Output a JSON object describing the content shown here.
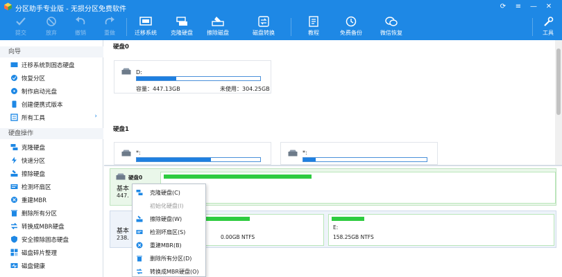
{
  "app": {
    "title": "分区助手专业版 - 无损分区免费软件"
  },
  "toolbar": {
    "buttons": [
      {
        "label": "提交",
        "icon": "check-icon",
        "disabled": true
      },
      {
        "label": "放弃",
        "icon": "cancel-icon",
        "disabled": true
      },
      {
        "label": "撤销",
        "icon": "undo-icon",
        "disabled": true
      },
      {
        "label": "重做",
        "icon": "redo-icon",
        "disabled": true
      },
      {
        "label": "迁移系统",
        "icon": "migrate-os-icon",
        "disabled": false
      },
      {
        "label": "克隆硬盘",
        "icon": "clone-disk-icon",
        "disabled": false
      },
      {
        "label": "擦除磁盘",
        "icon": "wipe-disk-icon",
        "disabled": false
      },
      {
        "label": "磁盘转换",
        "icon": "disk-convert-icon",
        "disabled": false
      },
      {
        "label": "教程",
        "icon": "tutorial-icon",
        "disabled": false
      },
      {
        "label": "免费备份",
        "icon": "free-backup-icon",
        "disabled": false
      },
      {
        "label": "微信恢复",
        "icon": "wechat-recovery-icon",
        "disabled": false
      },
      {
        "label": "工具",
        "icon": "tools-icon",
        "disabled": false
      }
    ]
  },
  "sidebar": {
    "wizard_title": "向导",
    "wizard_items": [
      {
        "label": "迁移系统到固态硬盘",
        "icon": "migrate-ssd-icon"
      },
      {
        "label": "恢复分区",
        "icon": "recover-partition-icon"
      },
      {
        "label": "制作启动光盘",
        "icon": "boot-disc-icon"
      },
      {
        "label": "创建便携式版本",
        "icon": "portable-version-icon"
      },
      {
        "label": "所有工具",
        "icon": "all-tools-icon"
      }
    ],
    "disk_ops_title": "硬盘操作",
    "disk_ops_items": [
      {
        "label": "克隆硬盘",
        "icon": "clone-disk-icon"
      },
      {
        "label": "快速分区",
        "icon": "quick-partition-icon"
      },
      {
        "label": "擦除硬盘",
        "icon": "wipe-disk-icon"
      },
      {
        "label": "检测坏扇区",
        "icon": "bad-sector-icon"
      },
      {
        "label": "重建MBR",
        "icon": "rebuild-mbr-icon"
      },
      {
        "label": "删除所有分区",
        "icon": "delete-partitions-icon"
      },
      {
        "label": "转换成MBR硬盘",
        "icon": "convert-mbr-icon"
      },
      {
        "label": "安全擦除固态硬盘",
        "icon": "secure-erase-icon"
      },
      {
        "label": "磁盘碎片整理",
        "icon": "defrag-icon"
      },
      {
        "label": "磁盘健康",
        "icon": "disk-health-icon"
      }
    ]
  },
  "disk_map": {
    "disk0": {
      "title": "硬盘0",
      "volume": "D:",
      "capacity": "容量：447.13GB",
      "unused": "未使用：304.25GB",
      "used_fraction": 0.32
    },
    "disk1": {
      "title": "硬盘1",
      "volumes": [
        {
          "label": "*:",
          "used_fraction": 0.6
        },
        {
          "label": "*:",
          "used_fraction": 0.1
        }
      ]
    }
  },
  "strip": {
    "row1": {
      "disk_label": "硬盘0",
      "type_prefix": "基本",
      "size_prefix": "447.",
      "used_fraction": 0.38
    },
    "row2": {
      "type_prefix": "基本",
      "size_prefix": "238.",
      "partitions": [
        {
          "label": "",
          "info": "0.00GB NTFS",
          "used_fraction": 0.55
        },
        {
          "label": "E:",
          "info": "158.25GB NTFS",
          "used_fraction": 0.15
        }
      ]
    }
  },
  "context_menu": {
    "items": [
      {
        "label": "克隆硬盘(C)",
        "icon": "clone-disk-icon",
        "disabled": false
      },
      {
        "label": "初始化硬盘(I)",
        "icon": "",
        "disabled": true
      },
      {
        "label": "擦除硬盘(W)",
        "icon": "wipe-disk-icon",
        "disabled": false
      },
      {
        "label": "检测坏扇区(S)",
        "icon": "bad-sector-icon",
        "disabled": false
      },
      {
        "label": "重建MBR(B)",
        "icon": "rebuild-mbr-icon",
        "disabled": false
      },
      {
        "label": "删除所有分区(D)",
        "icon": "delete-partitions-icon",
        "disabled": false
      },
      {
        "label": "转换成MBR硬盘(O)",
        "icon": "convert-mbr-icon",
        "disabled": false
      }
    ]
  },
  "colors": {
    "accent": "#1e88e5",
    "bar": "#1e7fe0",
    "green": "#2ecc40"
  }
}
